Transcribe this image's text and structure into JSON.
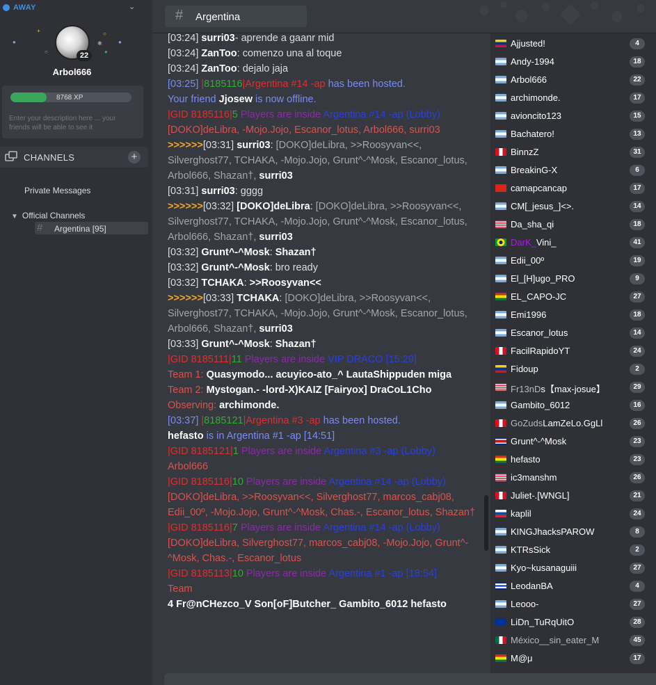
{
  "status": {
    "label": "AWAY",
    "dot_color": "#3d90e6"
  },
  "profile": {
    "username": "Arbol666",
    "level": "22",
    "xp_text": "8768 XP",
    "xp_fraction": 0.3,
    "description_placeholder": "Enter your description here ... your friends will be able to see it"
  },
  "nav": {
    "channels_title": "CHANNELS",
    "private_messages": "Private Messages",
    "official_channels": "Official Channels",
    "active_channel": "Argentina [95]"
  },
  "header": {
    "title": "Argentina"
  },
  "chat": [
    [
      [
        "ts",
        "[03:24] "
      ],
      [
        "nm",
        "surri03"
      ],
      [
        "",
        "- aprende a gaanr mid"
      ]
    ],
    [
      [
        "ts",
        "[03:24] "
      ],
      [
        "nm",
        "ZanToo"
      ],
      [
        "",
        ": comenzo una al toque"
      ]
    ],
    [
      [
        "ts",
        "[03:24] "
      ],
      [
        "nm",
        "ZanToo"
      ],
      [
        "",
        ": dejalo jaja"
      ]
    ],
    [
      [
        "blu",
        "[03:25] "
      ],
      [
        "bar",
        "|"
      ],
      [
        "grn",
        "8185116"
      ],
      [
        "bar",
        "|"
      ],
      [
        "red",
        "Argentina #14 -ap"
      ],
      [
        "blu",
        " has been hosted."
      ]
    ],
    [
      [
        "blu",
        "Your friend "
      ],
      [
        "nm",
        "Jjosew"
      ],
      [
        "blu",
        " is now offline."
      ]
    ],
    [
      [
        "bar",
        "|"
      ],
      [
        "red",
        "GID 8185116"
      ],
      [
        "bar",
        "|"
      ],
      [
        "grn",
        "5"
      ],
      [
        "pur",
        " Players are inside "
      ],
      [
        "dblue",
        "Argentina #14 -ap (Lobby)"
      ]
    ],
    [
      [
        "sal",
        "[DOKO]deLibra, -Mojo.Jojo, Escanor_lotus, Arbol666, surri03"
      ]
    ],
    [
      [
        "arr",
        ">>>>>>"
      ],
      [
        "ts",
        "[03:31] "
      ],
      [
        "nm",
        "surri03"
      ],
      [
        "",
        ": "
      ],
      [
        "gry",
        "[DOKO]deLibra, >>Roosyvan<<, Silverghost77, TCHAKA, -Mojo.Jojo, Grunt^-^Mosk, Escanor_lotus, Arbol666, Shazan†, "
      ],
      [
        "nm",
        "surri03"
      ]
    ],
    [
      [
        "ts",
        "[03:31] "
      ],
      [
        "nm",
        "surri03"
      ],
      [
        "",
        ": gggg"
      ]
    ],
    [
      [
        "arr",
        ">>>>>>"
      ],
      [
        "ts",
        "[03:32] "
      ],
      [
        "nm",
        "[DOKO]deLibra"
      ],
      [
        "",
        ": "
      ],
      [
        "gry",
        "[DOKO]deLibra, >>Roosyvan<<, Silverghost77, TCHAKA, -Mojo.Jojo, Grunt^-^Mosk, Escanor_lotus, Arbol666, Shazan†, "
      ],
      [
        "nm",
        "surri03"
      ]
    ],
    [
      [
        "ts",
        "[03:32] "
      ],
      [
        "nm",
        "Grunt^-^Mosk"
      ],
      [
        "",
        ": "
      ],
      [
        "nm",
        "Shazan†"
      ]
    ],
    [
      [
        "ts",
        "[03:32] "
      ],
      [
        "nm",
        "Grunt^-^Mosk"
      ],
      [
        "",
        ": bro ready"
      ]
    ],
    [
      [
        "ts",
        "[03:32] "
      ],
      [
        "nm",
        "TCHAKA"
      ],
      [
        "",
        ": "
      ],
      [
        "nm",
        ">>Roosyvan<<"
      ]
    ],
    [
      [
        "arr",
        ">>>>>>"
      ],
      [
        "ts",
        "[03:33] "
      ],
      [
        "nm",
        "TCHAKA"
      ],
      [
        "",
        ": "
      ],
      [
        "gry",
        "[DOKO]deLibra, >>Roosyvan<<, Silverghost77, TCHAKA, -Mojo.Jojo, Grunt^-^Mosk, Escanor_lotus, Arbol666, Shazan†, "
      ],
      [
        "nm",
        "surri03"
      ]
    ],
    [
      [
        "ts",
        "[03:33] "
      ],
      [
        "nm",
        "Grunt^-^Mosk"
      ],
      [
        "",
        ": "
      ],
      [
        "nm",
        "Shazan†"
      ]
    ],
    [
      [
        "bar",
        "|"
      ],
      [
        "red",
        "GID 8185111"
      ],
      [
        "bar",
        "|"
      ],
      [
        "grn",
        "11"
      ],
      [
        "pur",
        " Players are inside "
      ],
      [
        "dblue",
        "VIP DRACO [15:29]"
      ]
    ],
    [
      [
        "sal",
        "Team 1: "
      ],
      [
        "nm",
        "Quasymodo... acuyico-ato_^ LautaShippuden miga"
      ]
    ],
    [
      [
        "sal",
        "Team 2: "
      ],
      [
        "nm",
        "Mystogan.- -lord-X)KAIZ [Fairyox] DraCoL1Cho"
      ]
    ],
    [
      [
        "sal",
        "Observing: "
      ],
      [
        "nm",
        "archimonde."
      ]
    ],
    [
      [
        "blu",
        "[03:37] "
      ],
      [
        "bar",
        "|"
      ],
      [
        "grn",
        "8185121"
      ],
      [
        "bar",
        "|"
      ],
      [
        "red",
        "Argentina #3 -ap"
      ],
      [
        "blu",
        " has been hosted."
      ]
    ],
    [
      [
        "nm",
        "hefasto"
      ],
      [
        "blu",
        " is in Argentina #1 -ap [14:51]"
      ]
    ],
    [
      [
        "bar",
        "|"
      ],
      [
        "red",
        "GID 8185121"
      ],
      [
        "bar",
        "|"
      ],
      [
        "grn",
        "1"
      ],
      [
        "pur",
        " Players are inside "
      ],
      [
        "dblue",
        "Argentina #3 -ap (Lobby)"
      ]
    ],
    [
      [
        "sal",
        "Arbol666"
      ]
    ],
    [
      [
        "bar",
        "|"
      ],
      [
        "red",
        "GID 8185116"
      ],
      [
        "bar",
        "|"
      ],
      [
        "grn",
        "10"
      ],
      [
        "pur",
        " Players are inside "
      ],
      [
        "dblue",
        "Argentina #14 -ap (Lobby)"
      ]
    ],
    [
      [
        "sal",
        "[DOKO]deLibra, >>Roosyvan<<, Silverghost77, marcos_cabj08, Edii_00º, -Mojo.Jojo, Grunt^-^Mosk, Chas.-, Escanor_lotus, Shazan†"
      ]
    ],
    [
      [
        "bar",
        "|"
      ],
      [
        "red",
        "GID 8185116"
      ],
      [
        "bar",
        "|"
      ],
      [
        "grn",
        "7"
      ],
      [
        "pur",
        " Players are inside "
      ],
      [
        "dblue",
        "Argentina #14 -ap (Lobby)"
      ]
    ],
    [
      [
        "sal",
        "[DOKO]deLibra, Silverghost77, marcos_cabj08, -Mojo.Jojo, Grunt^-^Mosk, Chas.-, Escanor_lotus"
      ]
    ],
    [
      [
        "bar",
        "|"
      ],
      [
        "red",
        "GID 8185113"
      ],
      [
        "bar",
        "|"
      ],
      [
        "grn",
        "10"
      ],
      [
        "pur",
        " Players are inside "
      ],
      [
        "dblue",
        "Argentina #1 -ap [18:54]"
      ]
    ],
    [
      [
        "sal",
        "Team"
      ]
    ],
    [
      [
        "nm",
        "4 Fr@nCHezco_V Son[oF]Butcher_ Gambito_6012 hefasto"
      ]
    ]
  ],
  "users": [
    {
      "name": "Ajjusted!",
      "level": "4",
      "flag": "ve",
      "color": "#ffffff"
    },
    {
      "name": "Andy-1994",
      "level": "18",
      "flag": "ar",
      "color": "#ffffff"
    },
    {
      "name": "Arbol666",
      "level": "22",
      "flag": "ar",
      "color": "#ffffff"
    },
    {
      "name": "archimonde.",
      "level": "17",
      "flag": "ar",
      "color": "#ffffff"
    },
    {
      "name": "avioncito123",
      "level": "15",
      "flag": "ar",
      "color": "#ffffff"
    },
    {
      "name": "Bachatero!",
      "level": "13",
      "flag": "ar",
      "color": "#ffffff"
    },
    {
      "name": "BinnzZ",
      "level": "31",
      "flag": "pe",
      "color": "#ffffff"
    },
    {
      "name": "BreakinG-X",
      "level": "6",
      "flag": "ar",
      "color": "#ffffff"
    },
    {
      "name": "camapcancap",
      "level": "17",
      "flag": "vn",
      "color": "#ffffff"
    },
    {
      "name": "CM[_jesus_]<>.",
      "level": "14",
      "flag": "ar",
      "color": "#ffffff"
    },
    {
      "name": "Da_sha_qi",
      "level": "18",
      "flag": "us",
      "color": "#ffffff"
    },
    {
      "name": "DarK_Vini_",
      "level": "41",
      "flag": "br",
      "color": "#a61ee0",
      "color2": "#ffffff",
      "split": 5
    },
    {
      "name": "Edii_00º",
      "level": "19",
      "flag": "ar",
      "color": "#ffffff"
    },
    {
      "name": "El_[H]ugo_PRO",
      "level": "9",
      "flag": "ar",
      "color": "#ffffff"
    },
    {
      "name": "EL_CAPO-JC",
      "level": "27",
      "flag": "bo",
      "color": "#ffffff"
    },
    {
      "name": "Emi1996",
      "level": "18",
      "flag": "ar",
      "color": "#ffffff"
    },
    {
      "name": "Escanor_lotus",
      "level": "14",
      "flag": "ar",
      "color": "#ffffff"
    },
    {
      "name": "FacilRapidoYT",
      "level": "24",
      "flag": "pe",
      "color": "#ffffff"
    },
    {
      "name": "Fidoup",
      "level": "2",
      "flag": "ve",
      "color": "#ffffff"
    },
    {
      "name": "Fr13nDs【max-josue】",
      "level": "29",
      "flag": "us",
      "color": "#b9bbbe",
      "color2": "#ffffff",
      "split": 6
    },
    {
      "name": "Gambito_6012",
      "level": "16",
      "flag": "ar",
      "color": "#ffffff"
    },
    {
      "name": "GoZudsLamZeLo.GgLl",
      "level": "26",
      "flag": "pe",
      "color": "#b9bbbe",
      "color2": "#ffffff",
      "split": 6
    },
    {
      "name": "Grunt^-^Mosk",
      "level": "23",
      "flag": "cr",
      "color": "#ffffff"
    },
    {
      "name": "hefasto",
      "level": "23",
      "flag": "bo",
      "color": "#ffffff"
    },
    {
      "name": "ic3manshm",
      "level": "26",
      "flag": "us",
      "color": "#ffffff"
    },
    {
      "name": "Juliet-.[WNGL]",
      "level": "21",
      "flag": "pe",
      "color": "#ffffff"
    },
    {
      "name": "kaplil",
      "level": "24",
      "flag": "sk",
      "color": "#ffffff"
    },
    {
      "name": "KINGJhacksPAROW",
      "level": "8",
      "flag": "ar",
      "color": "#ffffff"
    },
    {
      "name": "KTRsSick",
      "level": "2",
      "flag": "ar",
      "color": "#ffffff"
    },
    {
      "name": "Kyo~kusanaguiii",
      "level": "27",
      "flag": "ar",
      "color": "#ffffff"
    },
    {
      "name": "LeodanBA",
      "level": "4",
      "flag": "cu",
      "color": "#ffffff"
    },
    {
      "name": "Leooo-",
      "level": "27",
      "flag": "ar",
      "color": "#ffffff"
    },
    {
      "name": "LiDn_TuRqUitO",
      "level": "28",
      "flag": "eu",
      "color": "#ffffff"
    },
    {
      "name": "México__sin_eater_M",
      "level": "45",
      "flag": "mx",
      "color": "#b9bbbe"
    },
    {
      "name": "M@μ",
      "level": "17",
      "flag": "bo",
      "color": "#ffffff"
    }
  ],
  "colors": {
    "sidebar": "#2f3136",
    "chat_bg": "#36393f",
    "accent_blue": "#3d90e6",
    "xp_green": "#3ba55c"
  }
}
